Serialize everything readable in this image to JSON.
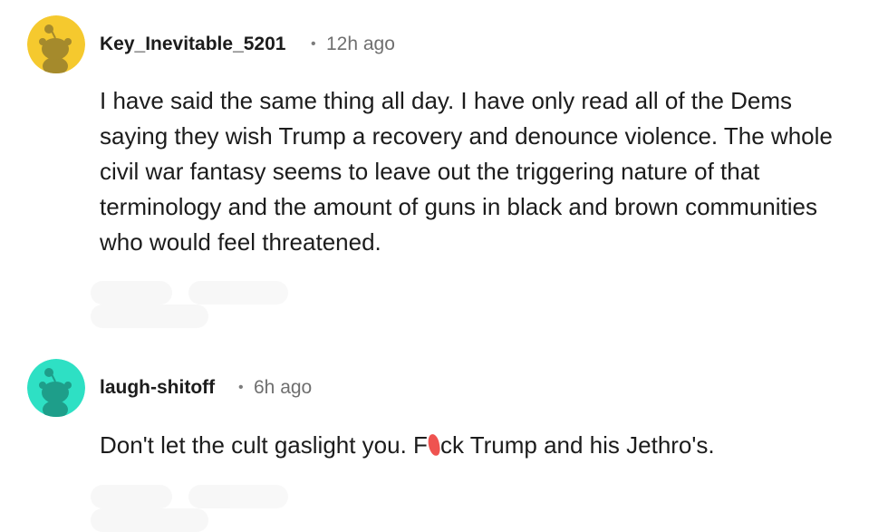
{
  "comments": [
    {
      "username": "Key_Inevitable_5201",
      "separator": "•",
      "time": "12h ago",
      "avatar_color": "#f5c92e",
      "avatar_icon": "snoo-avatar-icon",
      "body": "I have said the same thing all day. I have only read all of the Dems saying they wish Trump a recovery and denounce violence. The whole civil war fantasy seems to leave out the triggering nature of that terminology and the amount of guns in black and brown communities who would feel threatened."
    },
    {
      "username": "laugh-shitoff",
      "separator": "•",
      "time": "6h ago",
      "avatar_color": "#2ee0c4",
      "avatar_icon": "snoo-avatar-icon",
      "body_before": "Don't let the cult gaslight you. F",
      "body_after": "ck Trump and his Jethro's.",
      "censor_color": "#ef5350"
    }
  ]
}
